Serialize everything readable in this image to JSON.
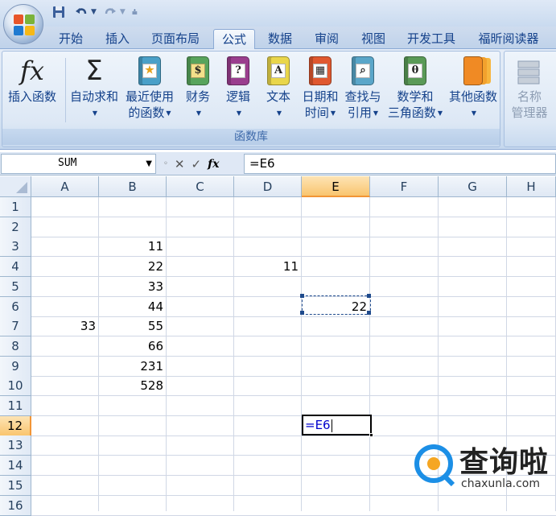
{
  "quick_access": {
    "save": "save-icon",
    "undo": "undo-icon",
    "redo": "redo-icon"
  },
  "tabs": [
    "开始",
    "插入",
    "页面布局",
    "公式",
    "数据",
    "审阅",
    "视图",
    "开发工具",
    "福昕阅读器"
  ],
  "active_tab": "公式",
  "ribbon": {
    "group_label": "函数库",
    "insert_function": {
      "icon": "fx",
      "label": "插入函数"
    },
    "autosum": {
      "icon": "Σ",
      "label": "自动求和"
    },
    "recent": {
      "line1": "最近使用",
      "line2": "的函数"
    },
    "financial": {
      "label": "财务"
    },
    "logical": {
      "label": "逻辑"
    },
    "text": {
      "label": "文本"
    },
    "datetime": {
      "line1": "日期和",
      "line2": "时间"
    },
    "lookup": {
      "line1": "查找与",
      "line2": "引用"
    },
    "math": {
      "line1": "数学和",
      "line2": "三角函数"
    },
    "more": {
      "label": "其他函数"
    },
    "name_manager": {
      "line1": "名称",
      "line2": "管理器"
    },
    "book_glyphs": {
      "logical": "?",
      "text": "A",
      "math": "θ"
    }
  },
  "formula_bar": {
    "name_box": "SUM",
    "formula": "=E6"
  },
  "columns": [
    "A",
    "B",
    "C",
    "D",
    "E",
    "F",
    "G",
    "H"
  ],
  "rows": [
    "1",
    "2",
    "3",
    "4",
    "5",
    "6",
    "7",
    "8",
    "9",
    "10",
    "11",
    "12",
    "13",
    "14",
    "15",
    "16"
  ],
  "cells": {
    "B3": "11",
    "B4": "22",
    "B5": "33",
    "B6": "44",
    "B7": "55",
    "B8": "66",
    "B9": "231",
    "B10": "528",
    "A7": "33",
    "D4": "11",
    "E6": "22"
  },
  "editing_cell": {
    "ref": "E12",
    "text": "=E6"
  },
  "watermark": {
    "name": "查询啦",
    "domain": "chaxunla.com"
  },
  "colors": {
    "accent": "#15428b",
    "selected_header": "#f9c56f",
    "ref_text": "#0000cc"
  }
}
